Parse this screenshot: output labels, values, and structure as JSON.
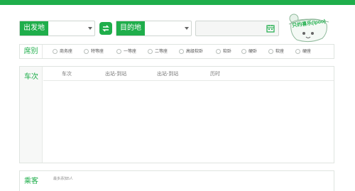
{
  "colors": {
    "brand": "#1fae4b",
    "border": "#dfe4e0"
  },
  "search": {
    "from_label": "出发地",
    "to_label": "目的地",
    "swap_icon": "swap-icon",
    "date_icon": "calendar-icon"
  },
  "mascot": {
    "text": "只约喜乐(Ipoo)"
  },
  "seats": {
    "title": "席别",
    "options": [
      "商务座",
      "特等座",
      "一等座",
      "二等座",
      "高级软卧",
      "软卧",
      "硬卧",
      "软座",
      "硬座"
    ]
  },
  "trains": {
    "title": "车次",
    "columns": [
      "车次",
      "出站-到站",
      "出站-到站",
      "历时"
    ]
  },
  "passenger": {
    "title": "乘客",
    "hint": "最多添加5人"
  }
}
